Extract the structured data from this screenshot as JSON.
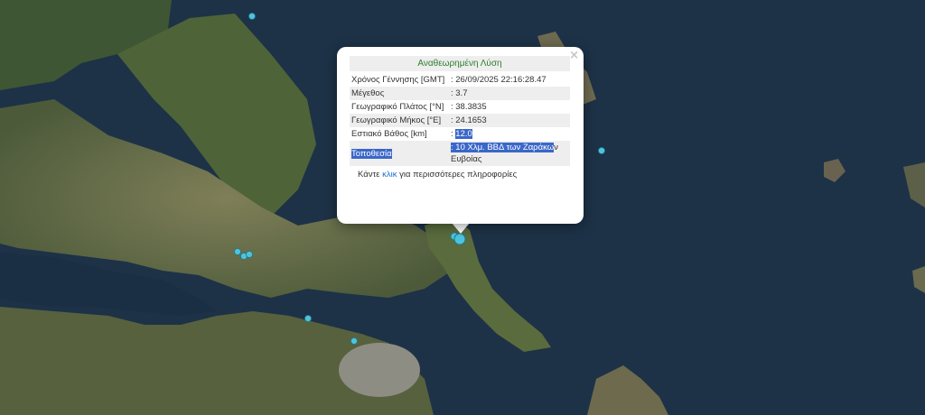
{
  "popup": {
    "title": "Αναθεωρημένη Λύση",
    "close": "×",
    "rows": [
      {
        "label": "Χρόνος Γέννησης [GMT]",
        "value": ": 26/09/2025 22:16:28.47"
      },
      {
        "label": "Μέγεθος",
        "value": ": 3.7"
      },
      {
        "label": "Γεωγραφικό Πλάτος [°N]",
        "value": ": 38.3835"
      },
      {
        "label": "Γεωγραφικό Μήκος [°E]",
        "value": ": 24.1653"
      },
      {
        "label": "Εστιακό Βάθος [km]",
        "value_prefix": ": ",
        "value": "12.0"
      },
      {
        "label": "Τοποθεσία",
        "value_prefix": ": ",
        "value": "10 Χλμ. ΒΒΔ των Ζαράκω",
        "value_suffix": "ν Ευβοίας"
      }
    ],
    "footer": {
      "prefix": "Κάντε ",
      "link": "κλικ",
      "suffix": " για περισσότερες πληροφορίες"
    }
  },
  "colors": {
    "marker": "#4fc3dc",
    "title": "#2e7d32",
    "link": "#1a6fd6",
    "highlight": "#3a67c9"
  }
}
